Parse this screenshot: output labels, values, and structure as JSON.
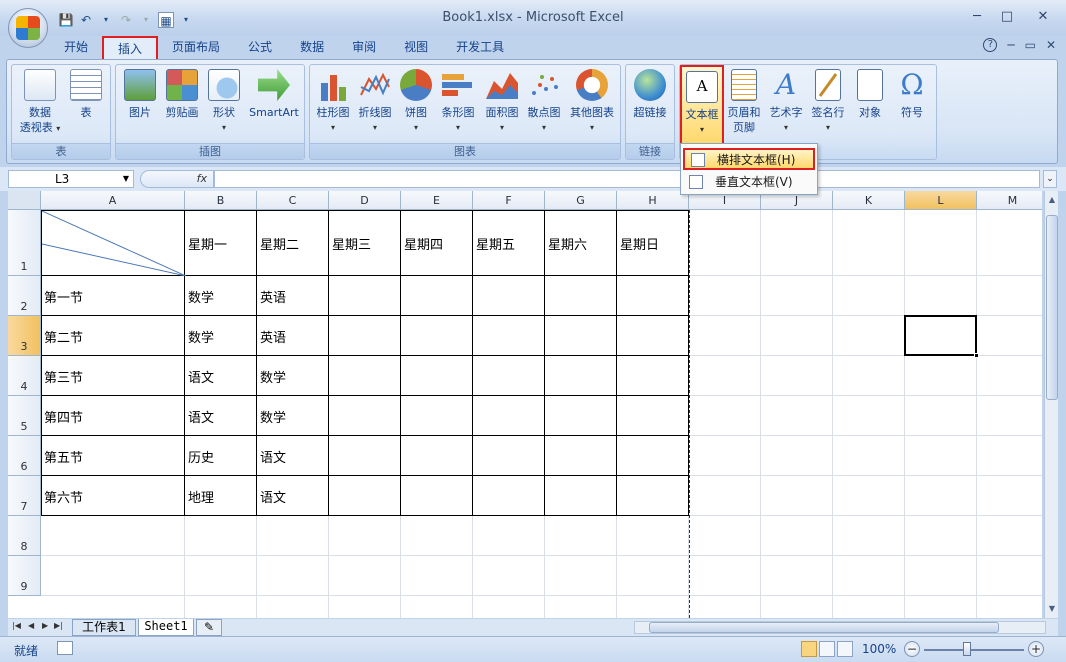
{
  "window": {
    "title": "Book1.xlsx - Microsoft Excel",
    "minimize": "─",
    "maximize": "□",
    "close": "✕",
    "doc_min": "─",
    "doc_restore": "▭",
    "doc_close": "✕",
    "help": "?"
  },
  "tabs": [
    "开始",
    "插入",
    "页面布局",
    "公式",
    "数据",
    "审阅",
    "视图",
    "开发工具"
  ],
  "ribbon": {
    "groups": {
      "tables": "表",
      "illustrations": "插图",
      "charts": "图表",
      "links": "链接"
    },
    "buttons": {
      "pivot_line1": "数据",
      "pivot_line2": "透视表",
      "table": "表",
      "picture": "图片",
      "clipart": "剪贴画",
      "shapes": "形状",
      "smartart": "SmartArt",
      "column": "柱形图",
      "line": "折线图",
      "pie": "饼图",
      "bar": "条形图",
      "area": "面积图",
      "scatter": "散点图",
      "other_charts": "其他图表",
      "hyperlink": "超链接",
      "textbox": "文本框",
      "header_footer_line1": "页眉和",
      "header_footer_line2": "页脚",
      "wordart": "艺术字",
      "signature": "签名行",
      "object": "对象",
      "symbol": "符号"
    }
  },
  "dropdown": {
    "items": [
      "横排文本框(H)",
      "垂直文本框(V)"
    ]
  },
  "formula_bar": {
    "name_box": "L3",
    "fx": "fx",
    "content": ""
  },
  "columns": [
    "A",
    "B",
    "C",
    "D",
    "E",
    "F",
    "G",
    "H",
    "I",
    "J",
    "K",
    "L",
    "M"
  ],
  "rows": [
    "1",
    "2",
    "3",
    "4",
    "5",
    "6",
    "7",
    "8",
    "9"
  ],
  "table": {
    "header": [
      "星期一",
      "星期二",
      "星期三",
      "星期四",
      "星期五",
      "星期六",
      "星期日"
    ],
    "rows": [
      {
        "label": "第一节",
        "b": "数学",
        "c": "英语"
      },
      {
        "label": "第二节",
        "b": "数学",
        "c": "英语"
      },
      {
        "label": "第三节",
        "b": "语文",
        "c": "数学"
      },
      {
        "label": "第四节",
        "b": "语文",
        "c": "数学"
      },
      {
        "label": "第五节",
        "b": "历史",
        "c": "语文"
      },
      {
        "label": "第六节",
        "b": "地理",
        "c": "语文"
      }
    ]
  },
  "sheets": [
    "工作表1",
    "Sheet1"
  ],
  "status": {
    "ready": "就绪",
    "zoom": "100%",
    "zoom_minus": "−",
    "zoom_plus": "+"
  }
}
